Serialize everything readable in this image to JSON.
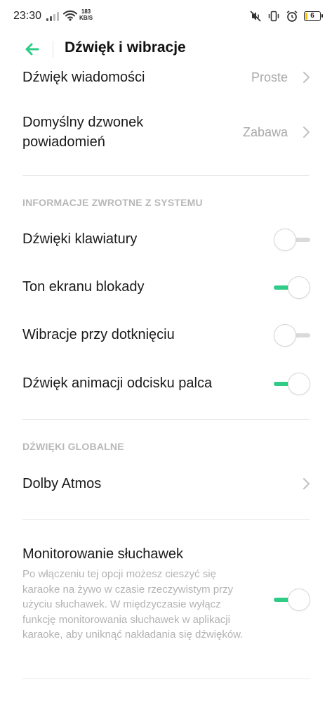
{
  "status_bar": {
    "time": "23:30",
    "net_speed_value": "183",
    "net_speed_unit": "KB/S",
    "battery": "6"
  },
  "header": {
    "title": "Dźwięk i wibracje"
  },
  "items": {
    "message_sound": {
      "label": "Dźwięk wiadomości",
      "value": "Proste"
    },
    "notification_ringtone": {
      "label": "Domyślny dzwonek powiadomień",
      "value": "Zabawa"
    }
  },
  "section_feedback": {
    "title": "INFORMACJE ZWROTNE Z SYSTEMU",
    "keyboard_sounds": {
      "label": "Dźwięki klawiatury",
      "on": false
    },
    "lock_screen_tone": {
      "label": "Ton ekranu blokady",
      "on": true
    },
    "touch_vibration": {
      "label": "Wibracje przy dotknięciu",
      "on": false
    },
    "fingerprint_sound": {
      "label": "Dźwięk animacji odcisku palca",
      "on": true
    }
  },
  "section_global": {
    "title": "DŹWIĘKI GLOBALNE",
    "dolby": {
      "label": "Dolby Atmos"
    },
    "headphone_monitoring": {
      "label": "Monitorowanie słuchawek",
      "description": "Po włączeniu tej opcji możesz cieszyć się karaoke na żywo w czasie rzeczywistym przy użyciu słuchawek. W międzyczasie wyłącz funkcję monitorowania słuchawek w aplikacji karaoke, aby uniknąć nakładania się dźwięków.",
      "on": true
    }
  },
  "colors": {
    "accent": "#2ecc87",
    "secondary_text": "#a8a8a8",
    "section_title": "#b8b8b8"
  }
}
